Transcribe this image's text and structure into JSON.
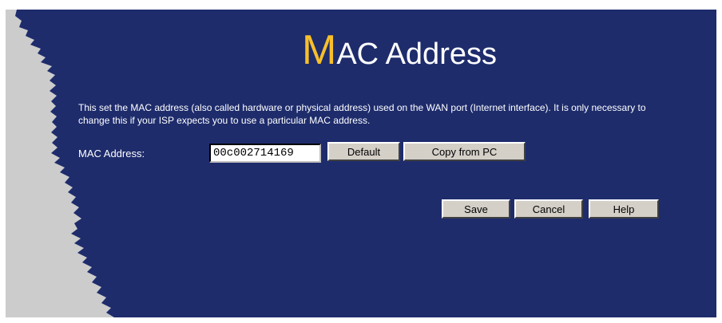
{
  "header": {
    "title_initial": "M",
    "title_rest": "AC Address"
  },
  "description": "This set the MAC address (also called hardware or physical address) used on the WAN port (Internet interface). It is only necessary to change this if your ISP expects you to use a particular MAC address.",
  "form": {
    "mac_label": "MAC Address:",
    "mac_value": "00c002714169",
    "default_label": "Default",
    "copy_label": "Copy from PC"
  },
  "actions": {
    "save_label": "Save",
    "cancel_label": "Cancel",
    "help_label": "Help"
  },
  "colors": {
    "panel_background": "#1e2c6c",
    "title_accent": "#f7bf2a",
    "torn_edge": "#cccccc"
  }
}
